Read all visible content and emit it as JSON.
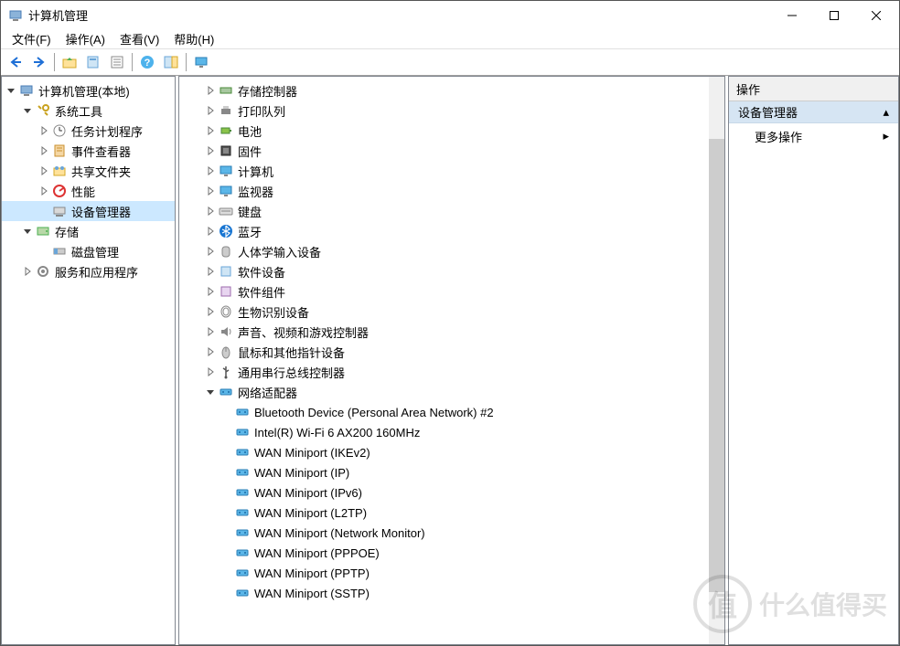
{
  "window": {
    "title": "计算机管理",
    "minimize": "—",
    "maximize": "☐",
    "close": "✕"
  },
  "menubar": [
    {
      "label": "文件(F)"
    },
    {
      "label": "操作(A)"
    },
    {
      "label": "查看(V)"
    },
    {
      "label": "帮助(H)"
    }
  ],
  "toolbar": [
    {
      "name": "back",
      "glyph": "arrow-left"
    },
    {
      "name": "forward",
      "glyph": "arrow-right"
    },
    {
      "name": "sep"
    },
    {
      "name": "up",
      "glyph": "folder-up"
    },
    {
      "name": "properties",
      "glyph": "page"
    },
    {
      "name": "list",
      "glyph": "page-list"
    },
    {
      "name": "sep"
    },
    {
      "name": "help",
      "glyph": "help"
    },
    {
      "name": "view",
      "glyph": "pane-toggle"
    },
    {
      "name": "sep"
    },
    {
      "name": "monitor",
      "glyph": "monitor"
    }
  ],
  "leftTree": [
    {
      "depth": 0,
      "exp": "open",
      "icon": "computer-mgmt",
      "label": "计算机管理(本地)"
    },
    {
      "depth": 1,
      "exp": "open",
      "icon": "tools",
      "label": "系统工具"
    },
    {
      "depth": 2,
      "exp": "closed",
      "icon": "task",
      "label": "任务计划程序"
    },
    {
      "depth": 2,
      "exp": "closed",
      "icon": "event",
      "label": "事件查看器"
    },
    {
      "depth": 2,
      "exp": "closed",
      "icon": "share",
      "label": "共享文件夹"
    },
    {
      "depth": 2,
      "exp": "closed",
      "icon": "perf",
      "label": "性能"
    },
    {
      "depth": 2,
      "exp": "none",
      "icon": "device",
      "label": "设备管理器",
      "selected": true
    },
    {
      "depth": 1,
      "exp": "open",
      "icon": "storage",
      "label": "存储"
    },
    {
      "depth": 2,
      "exp": "none",
      "icon": "disk",
      "label": "磁盘管理"
    },
    {
      "depth": 1,
      "exp": "closed",
      "icon": "services",
      "label": "服务和应用程序"
    }
  ],
  "centerTree": [
    {
      "depth": 0,
      "exp": "closed",
      "icon": "storage-ctrl",
      "label": "存储控制器"
    },
    {
      "depth": 0,
      "exp": "closed",
      "icon": "printer",
      "label": "打印队列"
    },
    {
      "depth": 0,
      "exp": "closed",
      "icon": "battery",
      "label": "电池"
    },
    {
      "depth": 0,
      "exp": "closed",
      "icon": "firmware",
      "label": "固件"
    },
    {
      "depth": 0,
      "exp": "closed",
      "icon": "computer",
      "label": "计算机"
    },
    {
      "depth": 0,
      "exp": "closed",
      "icon": "monitor",
      "label": "监视器"
    },
    {
      "depth": 0,
      "exp": "closed",
      "icon": "keyboard",
      "label": "键盘"
    },
    {
      "depth": 0,
      "exp": "closed",
      "icon": "bluetooth",
      "label": "蓝牙"
    },
    {
      "depth": 0,
      "exp": "closed",
      "icon": "hid",
      "label": "人体学输入设备"
    },
    {
      "depth": 0,
      "exp": "closed",
      "icon": "software",
      "label": "软件设备"
    },
    {
      "depth": 0,
      "exp": "closed",
      "icon": "component",
      "label": "软件组件"
    },
    {
      "depth": 0,
      "exp": "closed",
      "icon": "biometric",
      "label": "生物识别设备"
    },
    {
      "depth": 0,
      "exp": "closed",
      "icon": "audio",
      "label": "声音、视频和游戏控制器"
    },
    {
      "depth": 0,
      "exp": "closed",
      "icon": "mouse",
      "label": "鼠标和其他指针设备"
    },
    {
      "depth": 0,
      "exp": "closed",
      "icon": "usb",
      "label": "通用串行总线控制器"
    },
    {
      "depth": 0,
      "exp": "open",
      "icon": "network",
      "label": "网络适配器"
    },
    {
      "depth": 1,
      "exp": "none",
      "icon": "network",
      "label": "Bluetooth Device (Personal Area Network) #2"
    },
    {
      "depth": 1,
      "exp": "none",
      "icon": "network",
      "label": "Intel(R) Wi-Fi 6 AX200 160MHz"
    },
    {
      "depth": 1,
      "exp": "none",
      "icon": "network",
      "label": "WAN Miniport (IKEv2)"
    },
    {
      "depth": 1,
      "exp": "none",
      "icon": "network",
      "label": "WAN Miniport (IP)"
    },
    {
      "depth": 1,
      "exp": "none",
      "icon": "network",
      "label": "WAN Miniport (IPv6)"
    },
    {
      "depth": 1,
      "exp": "none",
      "icon": "network",
      "label": "WAN Miniport (L2TP)"
    },
    {
      "depth": 1,
      "exp": "none",
      "icon": "network",
      "label": "WAN Miniport (Network Monitor)"
    },
    {
      "depth": 1,
      "exp": "none",
      "icon": "network",
      "label": "WAN Miniport (PPPOE)"
    },
    {
      "depth": 1,
      "exp": "none",
      "icon": "network",
      "label": "WAN Miniport (PPTP)"
    },
    {
      "depth": 1,
      "exp": "none",
      "icon": "network",
      "label": "WAN Miniport (SSTP)"
    }
  ],
  "rightPane": {
    "header": "操作",
    "section": "设备管理器",
    "item": "更多操作"
  },
  "watermark": {
    "text": "什么值得买",
    "badge": "值"
  }
}
